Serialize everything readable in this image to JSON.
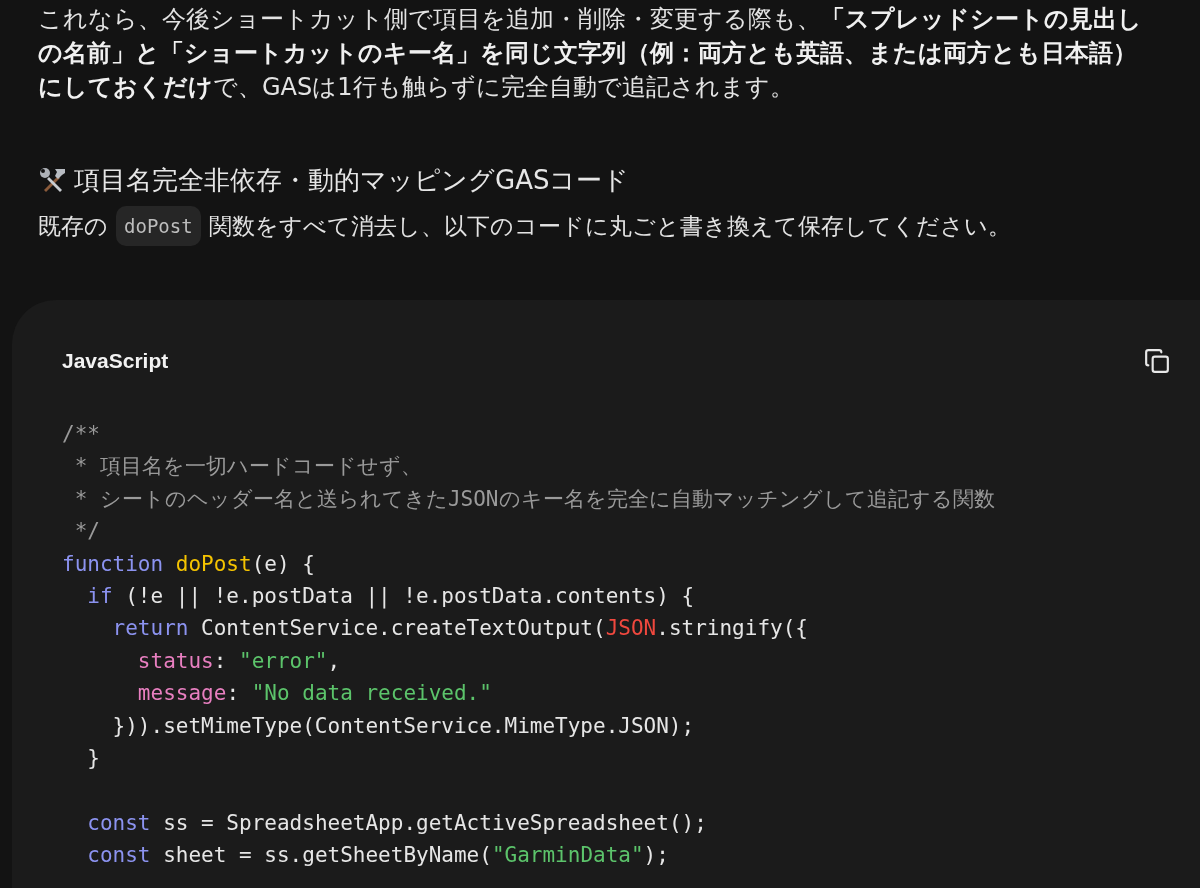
{
  "intro": "これなら、今後ショートカット側で項目を追加・削除・変更する際も、**「スプレッドシートの見出しの名前」と「ショートカットのキー名」を同じ文字列（例：両方とも英語、または両方とも日本語）にしておくだけ**で、GASは1行も触らずに完全自動で追記されます。",
  "heading": "項目名完全非依存・動的マッピングGASコード",
  "instruction": {
    "before": "既存の",
    "code": "doPost",
    "after": "関数をすべて消去し、以下のコードに丸ごと書き換えて保存してください。"
  },
  "code_block": {
    "language": "JavaScript",
    "lines": [
      [
        {
          "kind": "comment",
          "text": "/**"
        }
      ],
      [
        {
          "kind": "comment",
          "text": " * 項目名を一切ハードコードせず、"
        }
      ],
      [
        {
          "kind": "comment",
          "text": " * シートのヘッダー名と送られてきたJSONのキー名を完全に自動マッチングして追記する関数"
        }
      ],
      [
        {
          "kind": "comment",
          "text": " */"
        }
      ],
      [
        {
          "kind": "keyword",
          "text": "function "
        },
        {
          "kind": "function",
          "text": "doPost"
        },
        {
          "kind": "plain",
          "text": "(e) {"
        }
      ],
      [
        {
          "kind": "keyword",
          "text": "  if"
        },
        {
          "kind": "plain",
          "text": " (!e || !e.postData || !e.postData.contents) {"
        }
      ],
      [
        {
          "kind": "keyword",
          "text": "    return"
        },
        {
          "kind": "plain",
          "text": " ContentService.createTextOutput("
        },
        {
          "kind": "builtin",
          "text": "JSON"
        },
        {
          "kind": "plain",
          "text": ".stringify({"
        }
      ],
      [
        {
          "kind": "property",
          "text": "      status"
        },
        {
          "kind": "plain",
          "text": ": "
        },
        {
          "kind": "string",
          "text": "\"error\""
        },
        {
          "kind": "plain",
          "text": ","
        }
      ],
      [
        {
          "kind": "property",
          "text": "      message"
        },
        {
          "kind": "plain",
          "text": ": "
        },
        {
          "kind": "string",
          "text": "\"No data received.\""
        }
      ],
      [
        {
          "kind": "plain",
          "text": "    })).setMimeType(ContentService.MimeType.JSON);"
        }
      ],
      [
        {
          "kind": "plain",
          "text": "  }"
        }
      ],
      [
        {
          "kind": "keyword",
          "text": "  const",
          "gap_before": true
        },
        {
          "kind": "plain",
          "text": " ss = SpreadsheetApp.getActiveSpreadsheet();"
        }
      ],
      [
        {
          "kind": "keyword",
          "text": "  const"
        },
        {
          "kind": "plain",
          "text": " sheet = ss.getSheetByName("
        },
        {
          "kind": "string",
          "text": "\"GarminData\""
        },
        {
          "kind": "plain",
          "text": ");"
        }
      ]
    ]
  }
}
